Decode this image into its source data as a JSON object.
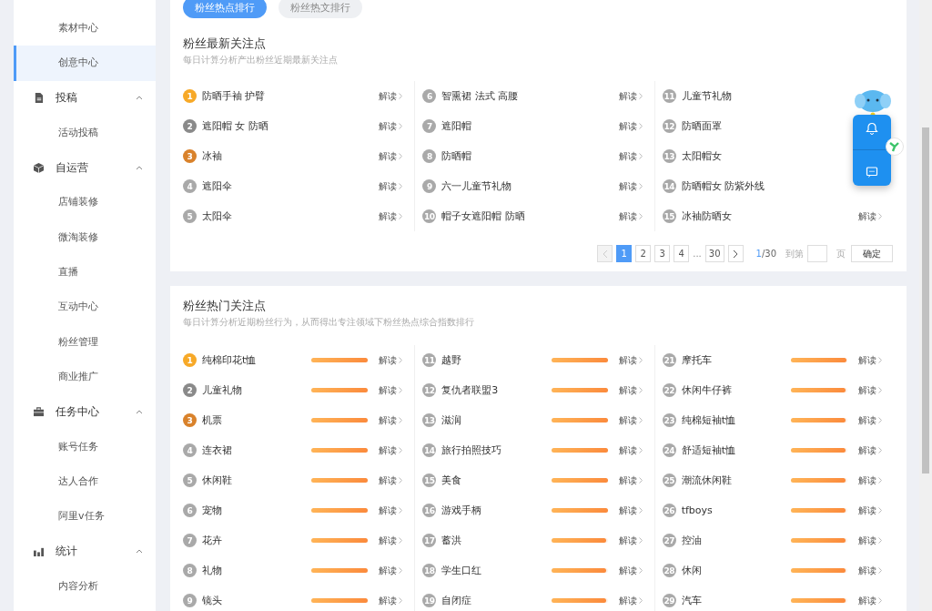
{
  "sidebar": {
    "items": [
      {
        "kind": "item",
        "label": "素材中心",
        "selected": false
      },
      {
        "kind": "item",
        "label": "创意中心",
        "selected": true
      },
      {
        "kind": "group",
        "label": "投稿",
        "expanded": true,
        "children": [
          {
            "label": "活动投稿",
            "selected": false
          }
        ]
      },
      {
        "kind": "group",
        "label": "自运营",
        "expanded": true,
        "children": [
          {
            "label": "店铺装修",
            "selected": false
          },
          {
            "label": "微淘装修",
            "selected": false
          },
          {
            "label": "直播",
            "selected": false
          },
          {
            "label": "互动中心",
            "selected": false
          },
          {
            "label": "粉丝管理",
            "selected": false
          },
          {
            "label": "商业推广",
            "selected": false
          }
        ]
      },
      {
        "kind": "group",
        "label": "任务中心",
        "expanded": true,
        "children": [
          {
            "label": "账号任务",
            "selected": false
          },
          {
            "label": "达人合作",
            "selected": false
          },
          {
            "label": "阿里v任务",
            "selected": false
          }
        ]
      },
      {
        "kind": "group",
        "label": "统计",
        "expanded": true,
        "children": [
          {
            "label": "内容分析",
            "selected": false
          }
        ]
      }
    ]
  },
  "tabs": [
    {
      "label": "粉丝热点排行",
      "selected": true
    },
    {
      "label": "粉丝热文排行",
      "selected": false
    }
  ],
  "latest": {
    "title": "粉丝最新关注点",
    "subtitle": "每日计算分析产出粉丝近期最新关注点",
    "columns": [
      [
        {
          "rank": "1",
          "name": "防晒手袖 护臂",
          "color": "#f7a928",
          "read": "解读"
        },
        {
          "rank": "2",
          "name": "遮阳帽 女 防晒",
          "color": "#8a8a8a",
          "read": "解读"
        },
        {
          "rank": "3",
          "name": "冰袖",
          "color": "#d9822b",
          "read": "解读"
        },
        {
          "rank": "4",
          "name": "遮阳伞",
          "color": "#a9a9a9",
          "read": "解读"
        },
        {
          "rank": "5",
          "name": "太阳伞",
          "color": "#a9a9a9",
          "read": "解读"
        }
      ],
      [
        {
          "rank": "6",
          "name": "智熏裙 法式 高腰",
          "color": "#a9a9a9",
          "read": "解读"
        },
        {
          "rank": "7",
          "name": "遮阳帽",
          "color": "#a9a9a9",
          "read": "解读"
        },
        {
          "rank": "8",
          "name": "防晒帽",
          "color": "#a9a9a9",
          "read": "解读"
        },
        {
          "rank": "9",
          "name": "六一儿童节礼物",
          "color": "#a9a9a9",
          "read": "解读"
        },
        {
          "rank": "10",
          "name": "帽子女遮阳帽 防晒",
          "color": "#a9a9a9",
          "read": "解读"
        }
      ],
      [
        {
          "rank": "11",
          "name": "儿童节礼物",
          "color": "#a9a9a9"
        },
        {
          "rank": "12",
          "name": "防晒面罩",
          "color": "#a9a9a9"
        },
        {
          "rank": "13",
          "name": "太阳帽女",
          "color": "#a9a9a9"
        },
        {
          "rank": "14",
          "name": "防晒帽女 防紫外线",
          "color": "#a9a9a9"
        },
        {
          "rank": "15",
          "name": "冰袖防晒女",
          "color": "#a9a9a9",
          "read": "解读"
        }
      ]
    ],
    "pagination": {
      "pages": [
        {
          "label": "1",
          "selected": true
        },
        {
          "label": "2",
          "selected": false
        },
        {
          "label": "3",
          "selected": false
        },
        {
          "label": "4",
          "selected": false
        },
        {
          "label": "...",
          "kind": "ellipsis"
        },
        {
          "label": "30",
          "selected": false
        }
      ],
      "prev_disabled": true,
      "current": "1",
      "total": "/30",
      "goto_label": "到第",
      "page_label": "页",
      "confirm": "确定"
    }
  },
  "hot": {
    "title": "粉丝热门关注点",
    "subtitle": "每日计算分析近期粉丝行为，从而得出专注领域下粉丝热点综合指数排行",
    "columns": [
      [
        {
          "rank": "1",
          "name": "纯棉印花t恤",
          "color": "#f7a928",
          "level": 1,
          "read": "解读"
        },
        {
          "rank": "2",
          "name": "儿童礼物",
          "color": "#8a8a8a",
          "level": 1,
          "read": "解读"
        },
        {
          "rank": "3",
          "name": "机票",
          "color": "#d9822b",
          "level": 1,
          "read": "解读"
        },
        {
          "rank": "4",
          "name": "连衣裙",
          "color": "#a9a9a9",
          "level": 1,
          "read": "解读"
        },
        {
          "rank": "5",
          "name": "休闲鞋",
          "color": "#a9a9a9",
          "level": 1,
          "read": "解读"
        },
        {
          "rank": "6",
          "name": "宠物",
          "color": "#a9a9a9",
          "level": 1,
          "read": "解读"
        },
        {
          "rank": "7",
          "name": "花卉",
          "color": "#a9a9a9",
          "level": 1,
          "read": "解读"
        },
        {
          "rank": "8",
          "name": "礼物",
          "color": "#a9a9a9",
          "level": 1,
          "read": "解读"
        },
        {
          "rank": "9",
          "name": "镜头",
          "color": "#a9a9a9",
          "level": 1,
          "read": "解读"
        }
      ],
      [
        {
          "rank": "11",
          "name": "越野",
          "color": "#a9a9a9",
          "level": 1,
          "read": "解读"
        },
        {
          "rank": "12",
          "name": "复仇者联盟3",
          "color": "#a9a9a9",
          "level": 1,
          "read": "解读"
        },
        {
          "rank": "13",
          "name": "滋润",
          "color": "#a9a9a9",
          "level": 1,
          "read": "解读"
        },
        {
          "rank": "14",
          "name": "旅行拍照技巧",
          "color": "#a9a9a9",
          "level": 1,
          "read": "解读"
        },
        {
          "rank": "15",
          "name": "美食",
          "color": "#a9a9a9",
          "level": 1,
          "read": "解读"
        },
        {
          "rank": "16",
          "name": "游戏手柄",
          "color": "#a9a9a9",
          "level": 1,
          "read": "解读"
        },
        {
          "rank": "17",
          "name": "蓄洪",
          "color": "#a9a9a9",
          "level": 0.98,
          "read": "解读"
        },
        {
          "rank": "18",
          "name": "学生口红",
          "color": "#a9a9a9",
          "level": 0.98,
          "read": "解读"
        },
        {
          "rank": "19",
          "name": "自闭症",
          "color": "#a9a9a9",
          "level": 0.98,
          "read": "解读"
        }
      ],
      [
        {
          "rank": "21",
          "name": "摩托车",
          "color": "#a9a9a9",
          "level": 0.98,
          "read": "解读"
        },
        {
          "rank": "22",
          "name": "休闲牛仔裤",
          "color": "#a9a9a9",
          "level": 0.97,
          "read": "解读"
        },
        {
          "rank": "23",
          "name": "纯棉短袖t恤",
          "color": "#a9a9a9",
          "level": 0.97,
          "read": "解读"
        },
        {
          "rank": "24",
          "name": "舒适短袖t恤",
          "color": "#a9a9a9",
          "level": 0.97,
          "read": "解读"
        },
        {
          "rank": "25",
          "name": "潮流休闲鞋",
          "color": "#a9a9a9",
          "level": 0.97,
          "read": "解读"
        },
        {
          "rank": "26",
          "name": "tfboys",
          "color": "#a9a9a9",
          "level": 0.97,
          "read": "解读"
        },
        {
          "rank": "27",
          "name": "控油",
          "color": "#a9a9a9",
          "level": 0.96,
          "read": "解读"
        },
        {
          "rank": "28",
          "name": "休闲",
          "color": "#a9a9a9",
          "level": 0.96,
          "read": "解读"
        },
        {
          "rank": "29",
          "name": "汽车",
          "color": "#a9a9a9",
          "level": 0.96,
          "read": "解读"
        }
      ]
    ]
  }
}
